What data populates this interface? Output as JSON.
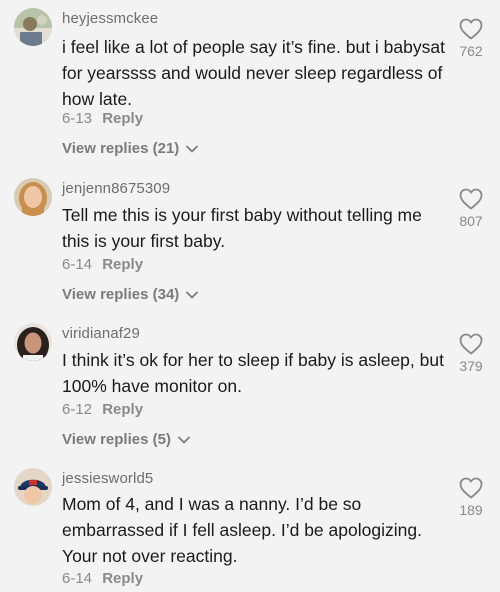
{
  "comments": [
    {
      "username": "heyjessmckee",
      "text": "i feel like a lot of people say it’s fine. but i babysat for yearssss and would never sleep regardless of how late.",
      "date": "6-13",
      "reply_label": "Reply",
      "view_replies": "View replies (21)",
      "likes": "762",
      "avatar_icon": "user-avatar-icon"
    },
    {
      "username": "jenjenn8675309",
      "text": "Tell me this is your first baby without telling me this is your first baby.",
      "date": "6-14",
      "reply_label": "Reply",
      "view_replies": "View replies (34)",
      "likes": "807",
      "avatar_icon": "user-avatar-icon"
    },
    {
      "username": "viridianaf29",
      "text": "I think it’s ok for her to sleep if baby is asleep, but 100% have monitor on.",
      "date": "6-12",
      "reply_label": "Reply",
      "view_replies": "View replies (5)",
      "likes": "379",
      "avatar_icon": "user-avatar-icon"
    },
    {
      "username": "jessiesworld5",
      "text": "Mom of 4, and I was a nanny. I’d be so embarrassed if I fell asleep. I’d be apologizing. Your not over reacting.",
      "date": "6-14",
      "reply_label": "Reply",
      "likes": "189",
      "avatar_icon": "user-avatar-icon"
    }
  ],
  "colors": {
    "background": "#f3f3f3",
    "primary_text": "#1a1a1a",
    "secondary_text": "#8a8a8a"
  }
}
